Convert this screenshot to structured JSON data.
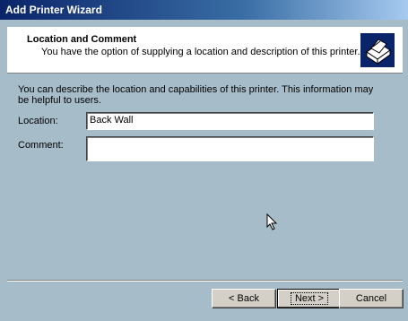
{
  "window": {
    "title": "Add Printer Wizard"
  },
  "header": {
    "title": "Location and Comment",
    "subtitle": "You have the option of supplying a location and description of this printer."
  },
  "main": {
    "intro": "You can describe the location and capabilities of this printer. This information may be helpful to users.",
    "location_label": "Location:",
    "location_value": "Back Wall",
    "comment_label": "Comment:",
    "comment_value": ""
  },
  "buttons": {
    "back": "< Back",
    "next": "Next >",
    "cancel": "Cancel"
  },
  "icons": {
    "header": "printer-icon",
    "pointer": "mouse-cursor-icon"
  },
  "colors": {
    "titlebar_start": "#0a246a",
    "titlebar_end": "#a6caf0",
    "panel": "#a7bcc9",
    "header_bg": "#ffffff"
  }
}
